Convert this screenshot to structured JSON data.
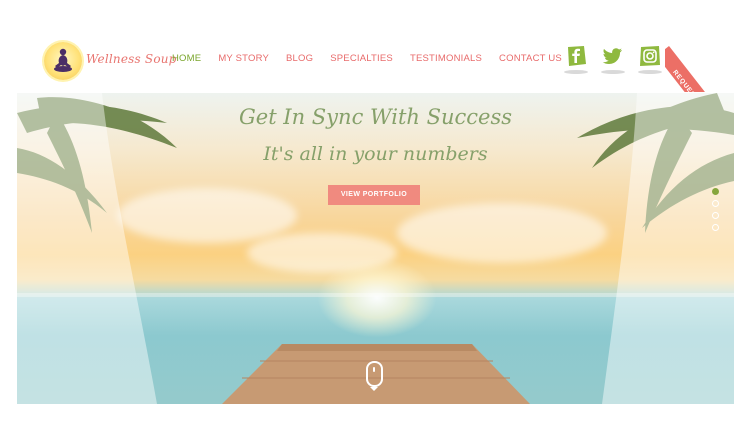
{
  "brand": {
    "name": "Wellness Soup",
    "logo_icon": "meditation-figure-icon"
  },
  "nav": {
    "items": [
      {
        "label": "HOME",
        "active": true
      },
      {
        "label": "MY STORY",
        "active": false
      },
      {
        "label": "BLOG",
        "active": false
      },
      {
        "label": "SPECIALTIES",
        "active": false
      },
      {
        "label": "TESTIMONIALS",
        "active": false
      },
      {
        "label": "CONTACT US",
        "active": false
      }
    ]
  },
  "social": [
    {
      "name": "facebook-icon",
      "color": "#8fb93f"
    },
    {
      "name": "twitter-icon",
      "color": "#8fb93f"
    },
    {
      "name": "instagram-icon",
      "color": "#8fb93f"
    }
  ],
  "ribbon": {
    "label": "REQUEST A QUOTE"
  },
  "hero": {
    "title": "Get In Sync With Success",
    "subtitle": "It's all in your numbers",
    "cta_label": "VIEW PORTFOLIO",
    "slides": [
      {
        "active": true
      },
      {
        "active": false
      },
      {
        "active": false
      },
      {
        "active": false
      }
    ],
    "scroll_icon": "mouse-scroll-icon"
  },
  "colors": {
    "accent_green": "#7aa52c",
    "nav_pink": "#e86b6b",
    "cta": "#f08a7f",
    "ribbon": "#ec6f66"
  }
}
